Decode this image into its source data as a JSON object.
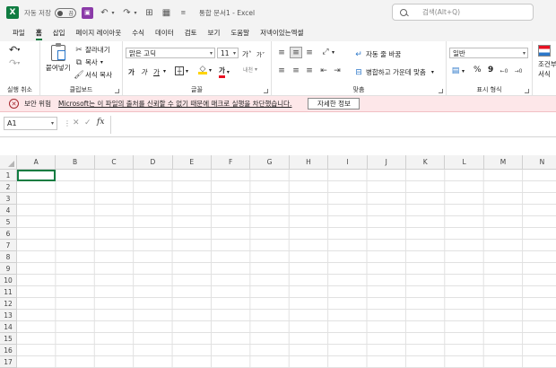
{
  "titlebar": {
    "logo_letter": "X",
    "autosave_label": "자동 저장",
    "autosave_state": "끔",
    "doc_title": "통합 문서1  -  Excel",
    "search_placeholder": "검색(Alt+Q)"
  },
  "menu": {
    "tabs": [
      "파일",
      "홈",
      "삽입",
      "페이지 레이아웃",
      "수식",
      "데이터",
      "검토",
      "보기",
      "도움말",
      "저넥이있는엑셀"
    ],
    "active": "홈"
  },
  "ribbon": {
    "undo_group": {
      "label": "실행 취소"
    },
    "clipboard": {
      "label": "클립보드",
      "paste": "붙여넣기",
      "cut": "잘라내기",
      "copy": "복사",
      "format_painter": "서식 복사"
    },
    "font": {
      "label": "글꼴",
      "font_name": "맑은 고딕",
      "font_size": "11",
      "grow": "가˄",
      "shrink": "가˅",
      "bold": "가",
      "italic": "가",
      "underline": "가",
      "font_color_glyph": "가",
      "phonetic": "내천"
    },
    "alignment": {
      "label": "맞춤",
      "wrap_text": "자동 줄 바꿈",
      "merge_center": "병합하고 가운데 맞춤"
    },
    "number": {
      "label": "표시 형식",
      "format": "일반",
      "percent": "%",
      "comma": "9"
    },
    "styles": {
      "conditional_line1": "조건부",
      "conditional_line2": "서식"
    }
  },
  "security_bar": {
    "title": "보안 위험",
    "message": "Microsoft는 이 파일의 출처를 신뢰할 수 없기 때문에 매크로 실행을 차단했습니다.",
    "button": "자세한 정보"
  },
  "formula_bar": {
    "name_box": "A1",
    "fx": "fx",
    "formula": ""
  },
  "grid": {
    "columns": [
      "A",
      "B",
      "C",
      "D",
      "E",
      "F",
      "G",
      "H",
      "I",
      "J",
      "K",
      "L",
      "M",
      "N"
    ],
    "rows": [
      "1",
      "2",
      "3",
      "4",
      "5",
      "6",
      "7",
      "8",
      "9",
      "10",
      "11",
      "12",
      "13",
      "14",
      "15",
      "16",
      "17"
    ]
  },
  "colors": {
    "excel_green": "#107c41",
    "security_bg": "#fde7e9"
  }
}
